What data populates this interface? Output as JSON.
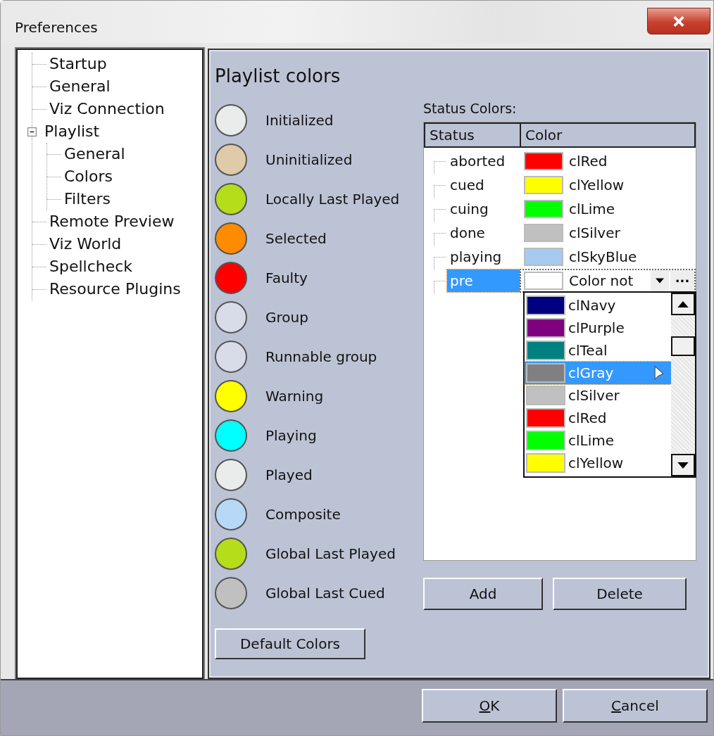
{
  "window": {
    "title": "Preferences"
  },
  "tree": [
    {
      "label": "Startup"
    },
    {
      "label": "General"
    },
    {
      "label": "Viz Connection"
    },
    {
      "label": "Playlist",
      "expanded": true,
      "children": [
        {
          "label": "General"
        },
        {
          "label": "Colors"
        },
        {
          "label": "Filters"
        }
      ]
    },
    {
      "label": "Remote Preview"
    },
    {
      "label": "Viz World"
    },
    {
      "label": "Spellcheck"
    },
    {
      "label": "Resource Plugins"
    }
  ],
  "playlist_colors": {
    "heading": "Playlist colors",
    "items": [
      {
        "label": "Initialized",
        "color": "#e9ecea"
      },
      {
        "label": "Uninitialized",
        "color": "#e0cba8"
      },
      {
        "label": "Locally Last Played",
        "color": "#b5dd1a"
      },
      {
        "label": "Selected",
        "color": "#ff8c00"
      },
      {
        "label": "Faulty",
        "color": "#ff0000"
      },
      {
        "label": "Group",
        "color": "#d8dbe8"
      },
      {
        "label": "Runnable group",
        "color": "#d8dbe8"
      },
      {
        "label": "Warning",
        "color": "#ffff00"
      },
      {
        "label": "Playing",
        "color": "#00ffff"
      },
      {
        "label": "Played",
        "color": "#e9ecea"
      },
      {
        "label": "Composite",
        "color": "#b8d8f8"
      },
      {
        "label": "Global Last Played",
        "color": "#b5dd1a"
      },
      {
        "label": "Global Last Cued",
        "color": "#c0c0c0"
      }
    ],
    "default_button": "Default Colors"
  },
  "status_colors": {
    "label": "Status Colors:",
    "columns": [
      "Status",
      "Color"
    ],
    "rows": [
      {
        "kind": "plain",
        "status": "aborted",
        "color": "#ff0000",
        "color_name": "clRed",
        "selected": false
      },
      {
        "kind": "plain",
        "status": "cued",
        "color": "#ffff00",
        "color_name": "clYellow",
        "selected": false
      },
      {
        "kind": "plain",
        "status": "cuing",
        "color": "#00ff00",
        "color_name": "clLime",
        "selected": false
      },
      {
        "kind": "plain",
        "status": "done",
        "color": "#c0c0c0",
        "color_name": "clSilver",
        "selected": false
      },
      {
        "kind": "plain",
        "status": "playing",
        "color": "#a6caf0",
        "color_name": "clSkyBlue",
        "selected": false
      },
      {
        "kind": "editor",
        "status": "pre",
        "color": "#ffffff",
        "color_name": "Color not",
        "selected": true,
        "more_button": "···"
      }
    ],
    "dropdown": {
      "open": true,
      "items": [
        {
          "name": "clNavy",
          "color": "#000080",
          "selected": false
        },
        {
          "name": "clPurple",
          "color": "#800080",
          "selected": false
        },
        {
          "name": "clTeal",
          "color": "#008080",
          "selected": false
        },
        {
          "name": "clGray",
          "color": "#808080",
          "selected": true
        },
        {
          "name": "clSilver",
          "color": "#c0c0c0",
          "selected": false
        },
        {
          "name": "clRed",
          "color": "#ff0000",
          "selected": false
        },
        {
          "name": "clLime",
          "color": "#00ff00",
          "selected": false
        },
        {
          "name": "clYellow",
          "color": "#ffff00",
          "selected": false
        }
      ]
    },
    "buttons": [
      "Add",
      "Delete"
    ]
  },
  "footer_buttons": [
    {
      "label": "OK",
      "underline_first": true
    },
    {
      "label": "Cancel",
      "underline_first": true
    }
  ]
}
